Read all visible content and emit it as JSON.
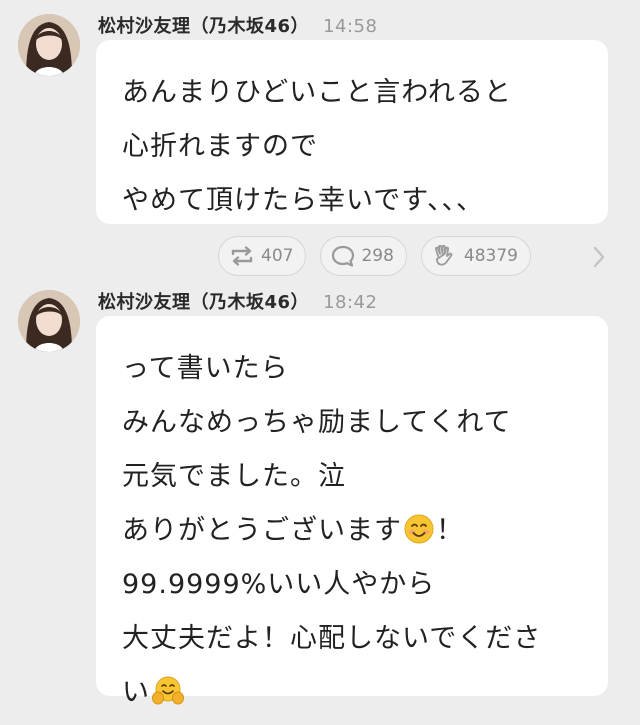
{
  "posts": [
    {
      "author": "松村沙友理（乃木坂46）",
      "time": "14:58",
      "lines": [
        "あんまりひどいこと言われると",
        "心折れますので",
        "やめて頂けたら幸いです、、、"
      ],
      "actions": {
        "retweet_count": "407",
        "comment_count": "298",
        "like_count": "48379"
      }
    },
    {
      "author": "松村沙友理（乃木坂46）",
      "time": "18:42",
      "lines": [
        "って書いたら",
        "みんなめっちゃ励ましてくれて",
        "元気でました。泣",
        "ありがとうございます",
        "99.9999%いい人やから",
        "大丈夫だよ！心配しないでくださ",
        "い"
      ],
      "line4_after_emoji": "！"
    }
  ],
  "icons": {
    "retweet": "retweet-icon",
    "comment": "comment-icon",
    "like": "clap-hand-icon",
    "next": "chevron-right-icon",
    "smile": "smiling-face-emoji",
    "hug": "hugging-face-emoji"
  },
  "colors": {
    "background": "#ededed",
    "bubble": "#ffffff",
    "text": "#222222",
    "time": "#9a9a9a",
    "action": "#8a8a8a"
  }
}
